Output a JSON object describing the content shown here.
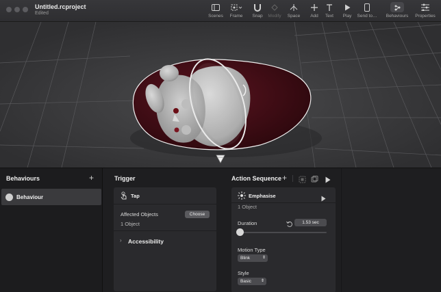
{
  "window": {
    "title": "Untitled.rcproject",
    "status": "Edited"
  },
  "toolbar": {
    "buttons": [
      {
        "label": "Scenes",
        "icon": "sidebar-icon"
      },
      {
        "label": "Frame",
        "icon": "frame-icon"
      },
      {
        "label": "Snap",
        "icon": "magnet-icon"
      },
      {
        "label": "Modify",
        "icon": "modify-icon"
      },
      {
        "label": "Space",
        "icon": "space-icon"
      },
      {
        "label": "Add",
        "icon": "plus-icon"
      },
      {
        "label": "Text",
        "icon": "text-icon"
      },
      {
        "label": "Play",
        "icon": "play-icon"
      },
      {
        "label": "Send to…",
        "icon": "send-to-device-icon"
      },
      {
        "label": "Behaviours",
        "icon": "behaviours-icon"
      },
      {
        "label": "Properties",
        "icon": "properties-icon"
      }
    ]
  },
  "behaviours": {
    "title": "Behaviours",
    "add": "+",
    "items": [
      {
        "label": "Behaviour"
      }
    ]
  },
  "trigger": {
    "title": "Trigger",
    "type_label": "Tap",
    "affected_label": "Affected Objects",
    "affected_value": "1 Object",
    "choose_label": "Choose",
    "accessibility_label": "Accessibility"
  },
  "action_sequence": {
    "title": "Action Sequence",
    "add": "+",
    "action_label": "Emphasise",
    "affected_value": "1 Object",
    "duration_label": "Duration",
    "duration_value": "1.53 sec",
    "duration_fraction": 0.03,
    "motion_type_label": "Motion Type",
    "motion_type_value": "Blink",
    "style_label": "Style",
    "style_value": "Basic"
  },
  "colors": {
    "accent": "#3b82f6",
    "panel": "#2a2a2d",
    "viewport": "#3a3a3c"
  }
}
